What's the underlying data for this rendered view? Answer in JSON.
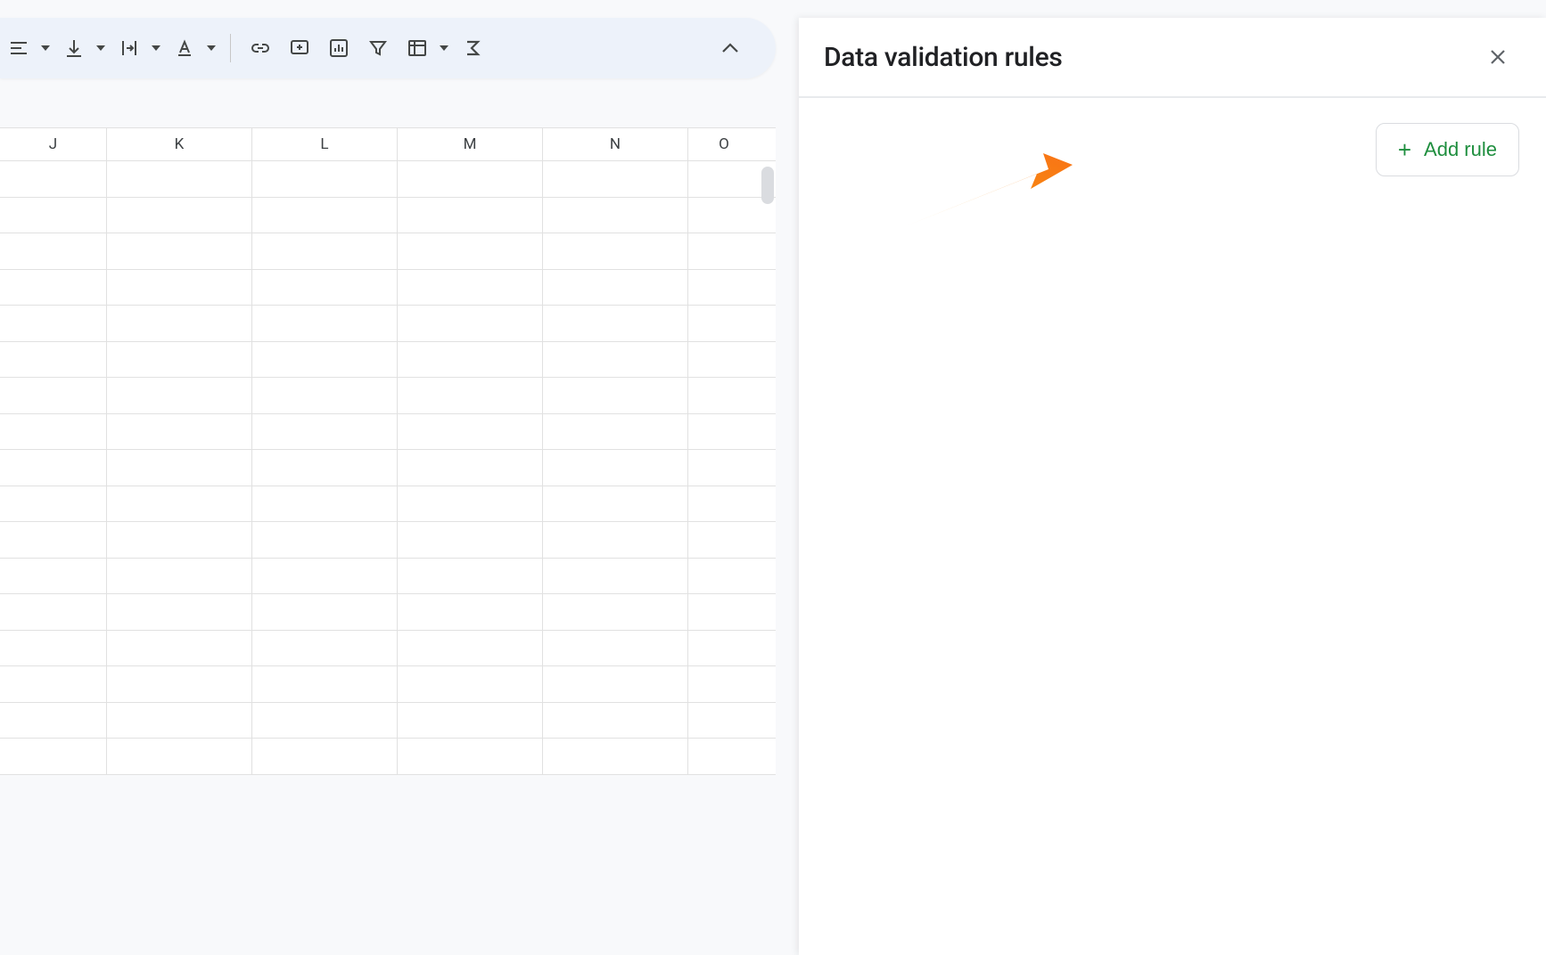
{
  "toolbar": {
    "buttons": [
      {
        "name": "align-button",
        "icon": "align",
        "has_dropdown": true
      },
      {
        "name": "valign-button",
        "icon": "valign",
        "has_dropdown": true
      },
      {
        "name": "wrap-button",
        "icon": "wrap",
        "has_dropdown": true
      },
      {
        "name": "text-rotation-button",
        "icon": "rotation",
        "has_dropdown": true
      }
    ],
    "buttons2": [
      {
        "name": "insert-link-button",
        "icon": "link"
      },
      {
        "name": "insert-comment-button",
        "icon": "comment"
      },
      {
        "name": "insert-chart-button",
        "icon": "chart"
      },
      {
        "name": "filter-button",
        "icon": "filter"
      },
      {
        "name": "filter-views-button",
        "icon": "table",
        "has_dropdown": true
      },
      {
        "name": "functions-button",
        "icon": "sigma"
      }
    ]
  },
  "columns": [
    "J",
    "K",
    "L",
    "M",
    "N",
    "O"
  ],
  "side_panel": {
    "title": "Data validation rules",
    "add_rule_label": "Add rule"
  }
}
